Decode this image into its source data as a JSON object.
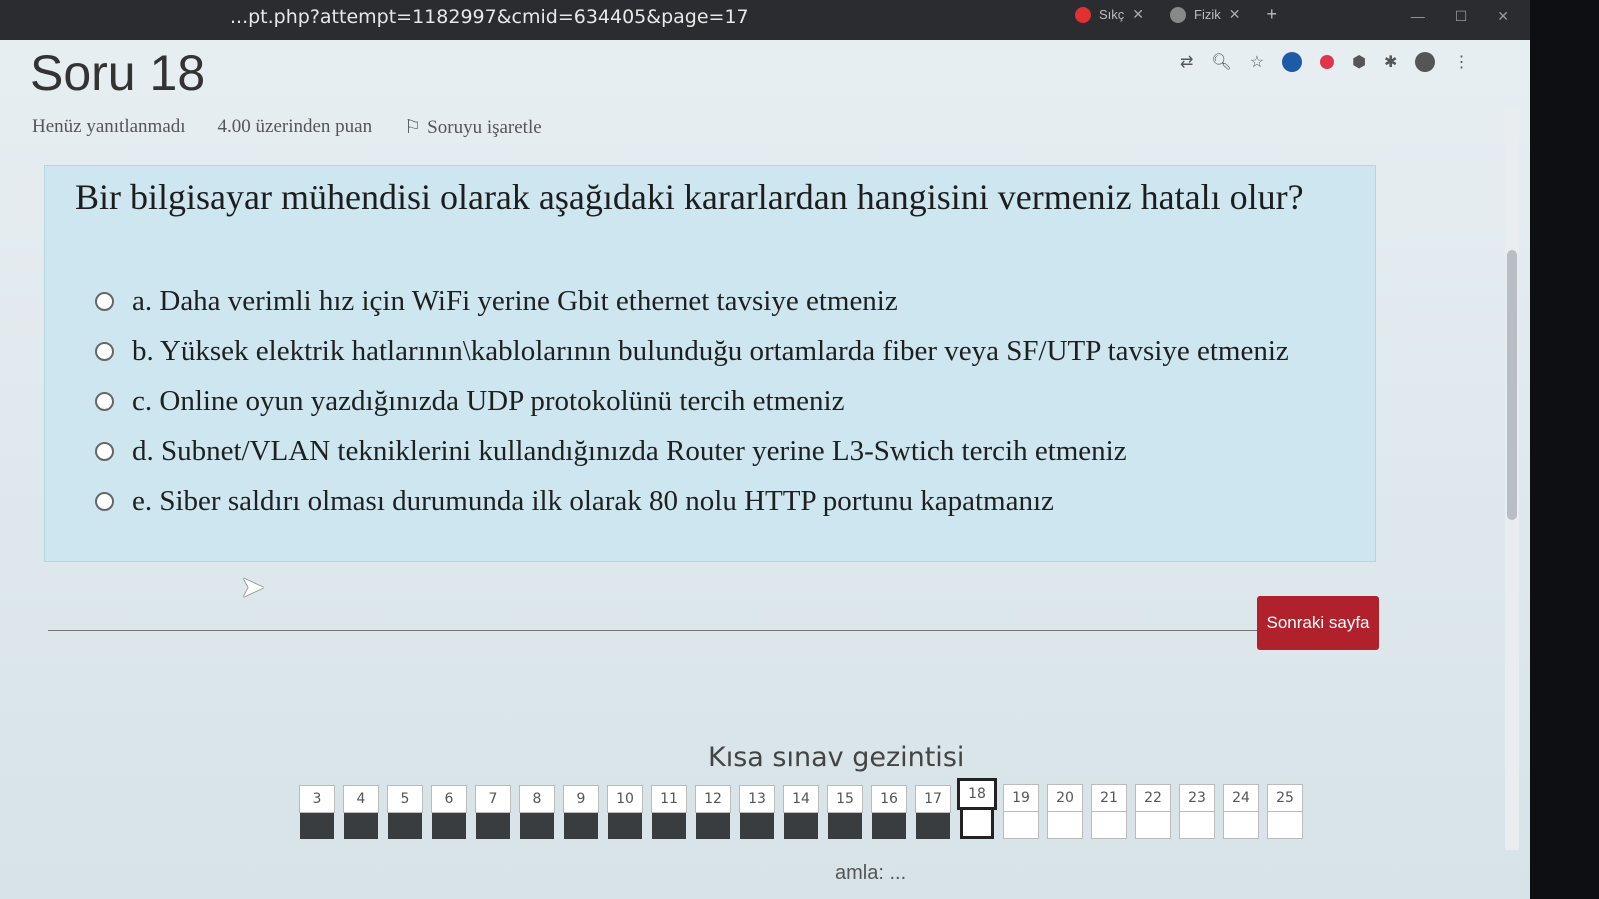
{
  "browser": {
    "url": "...pt.php?attempt=1182997&cmid=634405&page=17",
    "tabs": [
      {
        "label": "Sıkç",
        "icon": "opera-icon"
      },
      {
        "label": "Fizik",
        "icon": "google-icon"
      }
    ]
  },
  "quiz": {
    "title": "Soru 18",
    "status": "Henüz yanıtlanmadı",
    "points": "4.00 üzerinden puan",
    "flag_label": "Soruyu işaretle",
    "question": "Bir bilgisayar mühendisi olarak aşağıdaki kararlardan hangisini vermeniz hatalı olur?",
    "answers": [
      "a. Daha verimli hız için WiFi yerine Gbit ethernet tavsiye etmeniz",
      "b. Yüksek elektrik hatlarının\\kablolarının bulunduğu ortamlarda fiber veya SF/UTP tavsiye etmeniz",
      "c. Online oyun yazdığınızda UDP protokolünü tercih etmeniz",
      "d. Subnet/VLAN tekniklerini kullandığınızda Router yerine L3-Swtich tercih etmeniz",
      "e. Siber saldırı olması durumunda ilk olarak 80 nolu HTTP portunu kapatmanız"
    ],
    "next_button": "Sonraki sayfa"
  },
  "navigation": {
    "title": "Kısa sınav gezintisi",
    "questions": [
      "3",
      "4",
      "5",
      "6",
      "7",
      "8",
      "9",
      "10",
      "11",
      "12",
      "13",
      "14",
      "15",
      "16",
      "17",
      "18",
      "19",
      "20",
      "21",
      "22",
      "23",
      "24",
      "25"
    ],
    "current": "18",
    "answered_through": "17"
  },
  "footer_text": "amla: ..."
}
